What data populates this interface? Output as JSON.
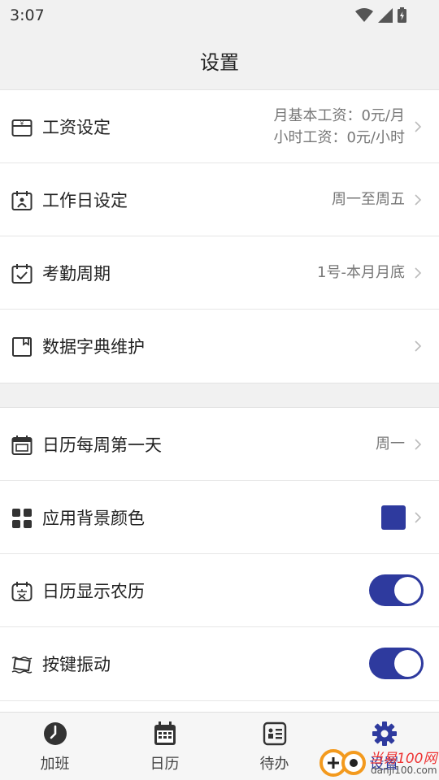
{
  "status": {
    "time": "3:07"
  },
  "appbar": {
    "title": "设置"
  },
  "group1": [
    {
      "label": "工资设定",
      "value_line1": "月基本工资：0元/月",
      "value_line2": "小时工资：0元/小时"
    },
    {
      "label": "工作日设定",
      "value": "周一至周五"
    },
    {
      "label": "考勤周期",
      "value": "1号-本月月底"
    },
    {
      "label": "数据字典维护"
    }
  ],
  "group2": [
    {
      "label": "日历每周第一天",
      "value": "周一"
    },
    {
      "label": "应用背景颜色",
      "swatch_color": "#2e3a9e"
    },
    {
      "label": "日历显示农历",
      "toggle_on": true
    },
    {
      "label": "按键振动",
      "toggle_on": true
    }
  ],
  "nav": [
    {
      "label": "加班",
      "icon": "clock-icon"
    },
    {
      "label": "日历",
      "icon": "calendar-icon"
    },
    {
      "label": "待办",
      "icon": "todo-card-icon"
    },
    {
      "label": "设置",
      "icon": "gear-icon",
      "active": true
    }
  ],
  "watermark": {
    "text1": "当易100网",
    "text2": "danji100.com"
  },
  "colors": {
    "accent": "#2e3a9e",
    "background": "#f1f1f1"
  }
}
